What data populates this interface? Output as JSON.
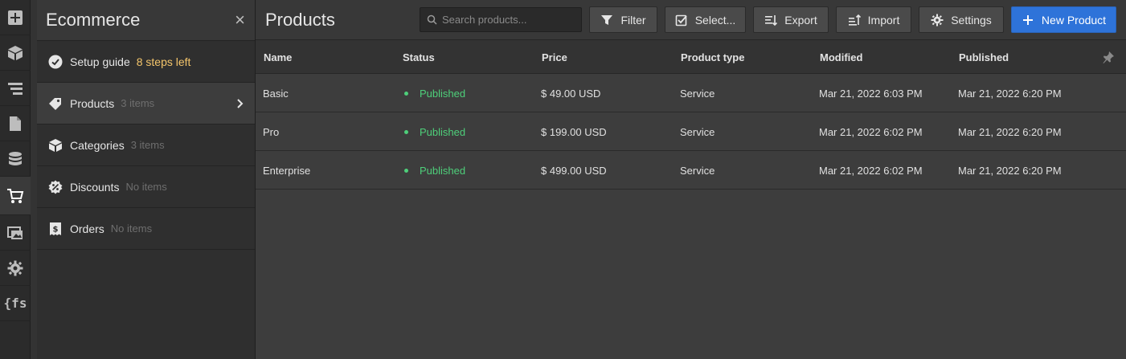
{
  "colors": {
    "accent": "#2e73d9",
    "published": "#4ecf7a",
    "warning": "#f4c56b",
    "muted": "#6e6e6e"
  },
  "rail": {
    "items": [
      {
        "icon": "add-icon"
      },
      {
        "icon": "box-icon"
      },
      {
        "icon": "layers-icon"
      },
      {
        "icon": "page-icon"
      },
      {
        "icon": "database-icon"
      },
      {
        "icon": "cart-icon",
        "active": true
      },
      {
        "icon": "assets-icon"
      },
      {
        "icon": "gear-icon"
      },
      {
        "icon": "fs-icon",
        "label": "{fs"
      }
    ]
  },
  "panel": {
    "title": "Ecommerce",
    "close_label": "×",
    "items": [
      {
        "label": "Setup guide",
        "extra": "8 steps left",
        "icon": "check-circle-icon"
      },
      {
        "label": "Products",
        "extra": "3 items",
        "icon": "tag-icon",
        "active": true
      },
      {
        "label": "Categories",
        "extra": "3 items",
        "icon": "box-icon"
      },
      {
        "label": "Discounts",
        "extra": "No items",
        "icon": "discount-icon"
      },
      {
        "label": "Orders",
        "extra": "No items",
        "icon": "dollar-receipt-icon"
      }
    ]
  },
  "main": {
    "title": "Products",
    "search": {
      "placeholder": "Search products..."
    },
    "toolbar": {
      "filter": "Filter",
      "select": "Select...",
      "export": "Export",
      "import": "Import",
      "settings": "Settings",
      "new_product": "New Product"
    },
    "table": {
      "columns": [
        "Name",
        "Status",
        "Price",
        "Product type",
        "Modified",
        "Published"
      ],
      "rows": [
        {
          "name": "Basic",
          "status": "Published",
          "price": "$ 49.00 USD",
          "type": "Service",
          "modified": "Mar 21, 2022 6:03 PM",
          "published": "Mar 21, 2022 6:20 PM"
        },
        {
          "name": "Pro",
          "status": "Published",
          "price": "$ 199.00 USD",
          "type": "Service",
          "modified": "Mar 21, 2022 6:02 PM",
          "published": "Mar 21, 2022 6:20 PM"
        },
        {
          "name": "Enterprise",
          "status": "Published",
          "price": "$ 499.00 USD",
          "type": "Service",
          "modified": "Mar 21, 2022 6:02 PM",
          "published": "Mar 21, 2022 6:20 PM"
        }
      ]
    }
  }
}
